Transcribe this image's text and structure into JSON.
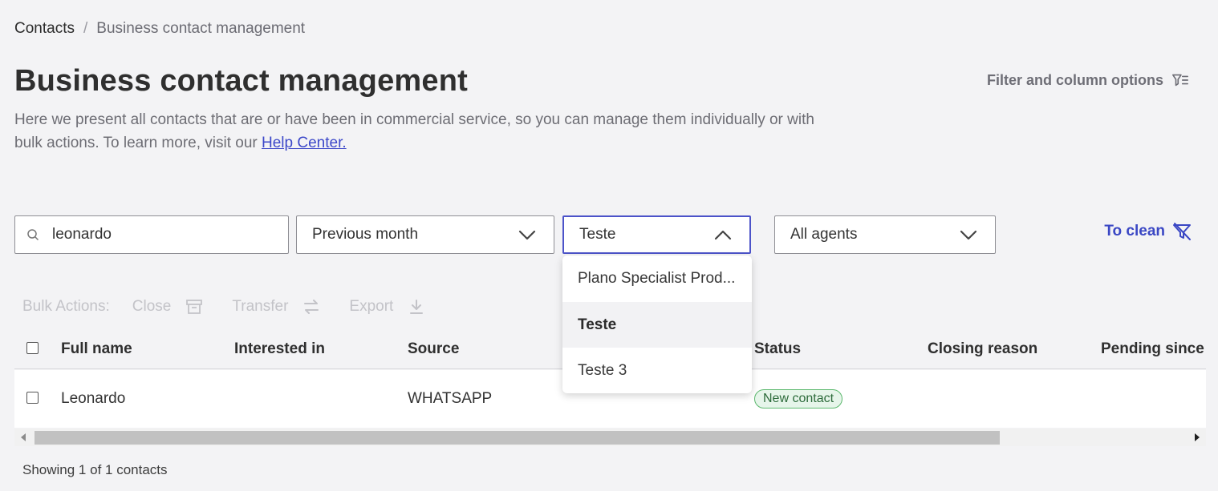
{
  "breadcrumb": {
    "root": "Contacts",
    "separator": "/",
    "current": "Business contact management"
  },
  "header": {
    "title": "Business contact management",
    "description": "Here we present all contacts that are or have been in commercial service, so you can manage them individually or with bulk actions. To learn more, visit our ",
    "help_link": "Help Center.",
    "filter_options": "Filter and column options"
  },
  "filters": {
    "search_value": "leonardo",
    "date_value": "Previous month",
    "plan_value": "Teste",
    "agents_value": "All agents",
    "clean_label": "To clean"
  },
  "dropdown": {
    "options": [
      "Plano Specialist Prod...",
      "Teste",
      "Teste 3"
    ],
    "selected": "Teste"
  },
  "bulk_actions": {
    "label": "Bulk Actions:",
    "close": "Close",
    "transfer": "Transfer",
    "export": "Export"
  },
  "table": {
    "columns": [
      "Full name",
      "Interested in",
      "Source",
      "Status",
      "Closing reason",
      "Pending since"
    ],
    "rows": [
      {
        "full_name": "Leonardo",
        "interested_in": "",
        "source": "WHATSAPP",
        "status": "New contact",
        "closing_reason": "",
        "pending_since": ""
      }
    ]
  },
  "footer": {
    "summary": "Showing 1 of 1 contacts"
  },
  "colors": {
    "accent": "#3a47c4",
    "focus_border": "#4c53c9",
    "status_green": "#5cb86e"
  }
}
